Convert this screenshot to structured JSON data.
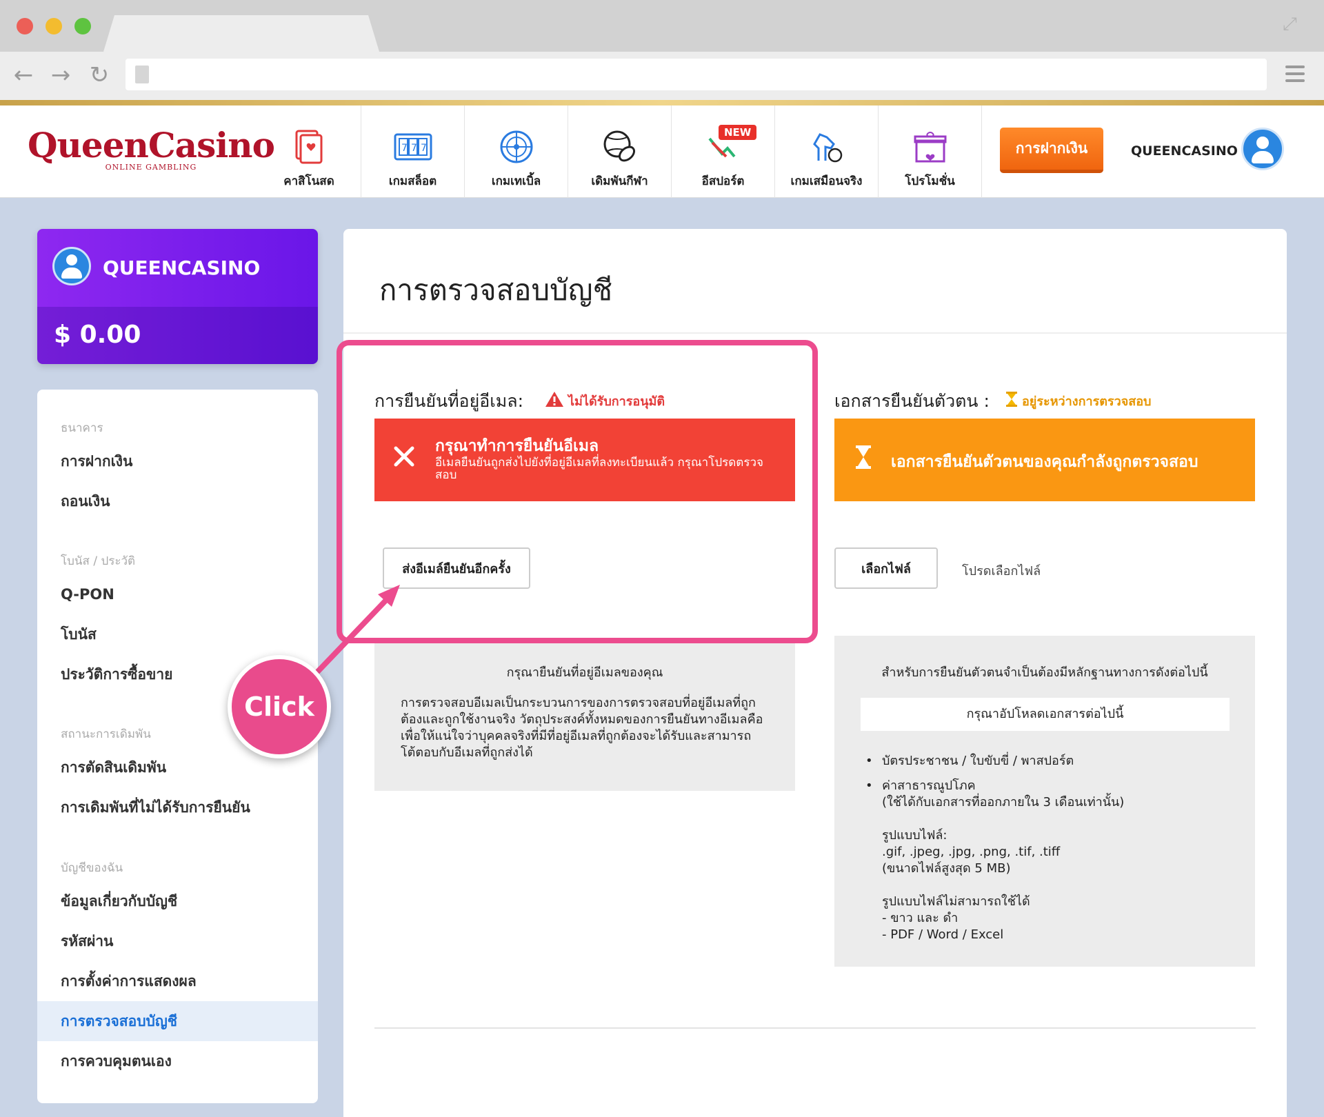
{
  "brand": {
    "logo_main": "QueenCasino",
    "logo_sub": "ONLINE GAMBLING"
  },
  "nav": {
    "items": [
      {
        "label": "คาสิโนสด",
        "icon": "live-casino-icon"
      },
      {
        "label": "เกมสล็อต",
        "icon": "slot-icon"
      },
      {
        "label": "เกมเทเบิ้ล",
        "icon": "roulette-icon"
      },
      {
        "label": "เดิมพันกีฬา",
        "icon": "sports-ball-icon"
      },
      {
        "label": "อีสปอร์ต",
        "icon": "esports-icon",
        "badge": "NEW"
      },
      {
        "label": "เกมเสมือนจริง",
        "icon": "virtual-horse-icon"
      },
      {
        "label": "โปรโมชั่น",
        "icon": "gift-icon"
      }
    ],
    "deposit_label": "การฝากเงิน",
    "username": "QUEENCASINO"
  },
  "account": {
    "name": "QUEENCASINO",
    "balance": "$ 0.00"
  },
  "sidebar": {
    "sections": [
      {
        "title": "ธนาคาร",
        "items": [
          "การฝากเงิน",
          "ถอนเงิน"
        ]
      },
      {
        "title": "โบนัส / ประวัติ",
        "items": [
          "Q-PON",
          "โบนัส",
          "ประวัติการซื้อขาย"
        ]
      },
      {
        "title": "สถานะการเดิมพัน",
        "items": [
          "การตัดสินเดิมพัน",
          "การเดิมพันที่ไม่ได้รับการยืนยัน"
        ]
      },
      {
        "title": "บัญชีของฉัน",
        "items": [
          "ข้อมูลเกี่ยวกับบัญชี",
          "รหัสผ่าน",
          "การตั้งค่าการแสดงผล",
          "การตรวจสอบบัญชี",
          "การควบคุมตนเอง"
        ]
      }
    ],
    "active": "การตรวจสอบบัญชี"
  },
  "main": {
    "title": "การตรวจสอบบัญชี",
    "email": {
      "label": "การยืนยันที่อยู่อีเมล:",
      "status": "ไม่ได้รับการอนุมัติ",
      "alert_title": "กรุณาทำการยืนยันอีเมล",
      "alert_desc": "อีเมลยืนยันถูกส่งไปยังที่อยู่อีเมลที่ลงทะเบียนแล้ว กรุณาโปรดตรวจสอบ",
      "resend_button": "ส่งอีเมล์ยืนยันอีกครั้ง",
      "info_header": "กรุณายืนยันที่อยู่อีเมลของคุณ",
      "info_body": "การตรวจสอบอีเมลเป็นกระบวนการของการตรวจสอบที่อยู่อีเมลที่ถูกต้องและถูกใช้งานจริง วัตถุประสงค์ทั้งหมดของการยืนยันทางอีเมลคือ เพื่อให้แน่ใจว่าบุคคลจริงที่มีที่อยู่อีเมลที่ถูกต้องจะได้รับและสามารถโต้ตอบกับอีเมลที่ถูกส่งได้"
    },
    "identity": {
      "label": "เอกสารยืนยันตัวตน :",
      "status": "อยู่ระหว่างการตรวจสอบ",
      "alert_title": "เอกสารยืนยันตัวตนของคุณกำลังถูกตรวจสอบ",
      "choose_button": "เลือกไฟล์",
      "choose_hint": "โปรดเลือกไฟล์",
      "info_header": "สำหรับการยืนยันตัวตนจำเป็นต้องมีหลักฐานทางการดังต่อไปนี้",
      "upload_header": "กรุณาอัปโหลดเอกสารต่อไปนี้",
      "bullets": [
        "บัตรประชาชน / ใบขับขี่ / พาสปอร์ต",
        "ค่าสาธารณูปโภค",
        "(ใช้ได้กับเอกสารที่ออกภายใน 3 เดือนเท่านั้น)"
      ],
      "formats_title": "รูปแบบไฟล์:",
      "formats": ".gif, .jpeg, .jpg, .png, .tif, .tiff",
      "max_size": "(ขนาดไฟล์สูงสุด 5 MB)",
      "not_allowed_title": "รูปแบบไฟล์ไม่สามารถใช้ได้",
      "not_allowed": [
        "- ขาว และ ดำ",
        "- PDF / Word / Excel"
      ]
    }
  },
  "overlay": {
    "click_label": "Click"
  },
  "colors": {
    "accent": "#1a6fd6",
    "error": "#f24236",
    "warning": "#fa9712",
    "highlight": "#ec4c8e",
    "purple": "#7a1cec"
  }
}
